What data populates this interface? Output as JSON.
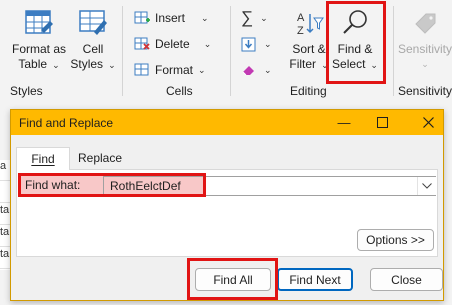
{
  "ribbon": {
    "format_as_table": {
      "line1": "Format as",
      "line2": "Table"
    },
    "cell_styles": {
      "line1": "Cell",
      "line2": "Styles"
    },
    "styles_group": "Styles",
    "insert": "Insert",
    "delete": "Delete",
    "format": "Format",
    "cells_group": "Cells",
    "sort_filter": {
      "line1": "Sort &",
      "line2": "Filter"
    },
    "find_select": {
      "line1": "Find &",
      "line2": "Select"
    },
    "editing_group": "Editing",
    "sensitivity": "Sensitivity",
    "sensitivity_group": "Sensitivity"
  },
  "grid_strip": [
    "a",
    "",
    "ta",
    "ta",
    "ta",
    "ta"
  ],
  "dialog": {
    "title": "Find and Replace",
    "tabs": {
      "find": "Find",
      "replace": "Replace"
    },
    "find_what_label": "Find what:",
    "find_what_value": "RothEelctDef",
    "options_button": "Options >>",
    "find_all_button": "Find All",
    "find_next_button": "Find Next",
    "close_button": "Close"
  },
  "colors": {
    "titlebar": "#ffb900",
    "highlight": "#e11414",
    "accent": "#0067c0"
  }
}
